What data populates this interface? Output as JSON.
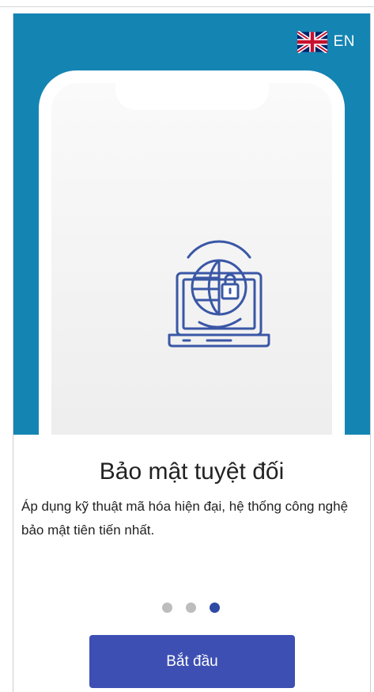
{
  "language_switch": {
    "label": "EN",
    "flag_icon": "uk-flag-icon"
  },
  "illustration": {
    "icon": "laptop-globe-lock-icon",
    "color": "#3a57a6"
  },
  "onboarding": {
    "title": "Bảo mật tuyệt đối",
    "description": "Áp dụng kỹ thuật mã hóa hiện đại, hệ thống công nghệ bảo mật tiên tiến nhất."
  },
  "pagination": {
    "total": 3,
    "active_index": 3
  },
  "cta": {
    "label": "Bắt đầu"
  },
  "colors": {
    "hero_background": "#1484b3",
    "primary_button": "#3d4fb3",
    "active_dot": "#2f4aa3",
    "inactive_dot": "#bdbdbd"
  }
}
